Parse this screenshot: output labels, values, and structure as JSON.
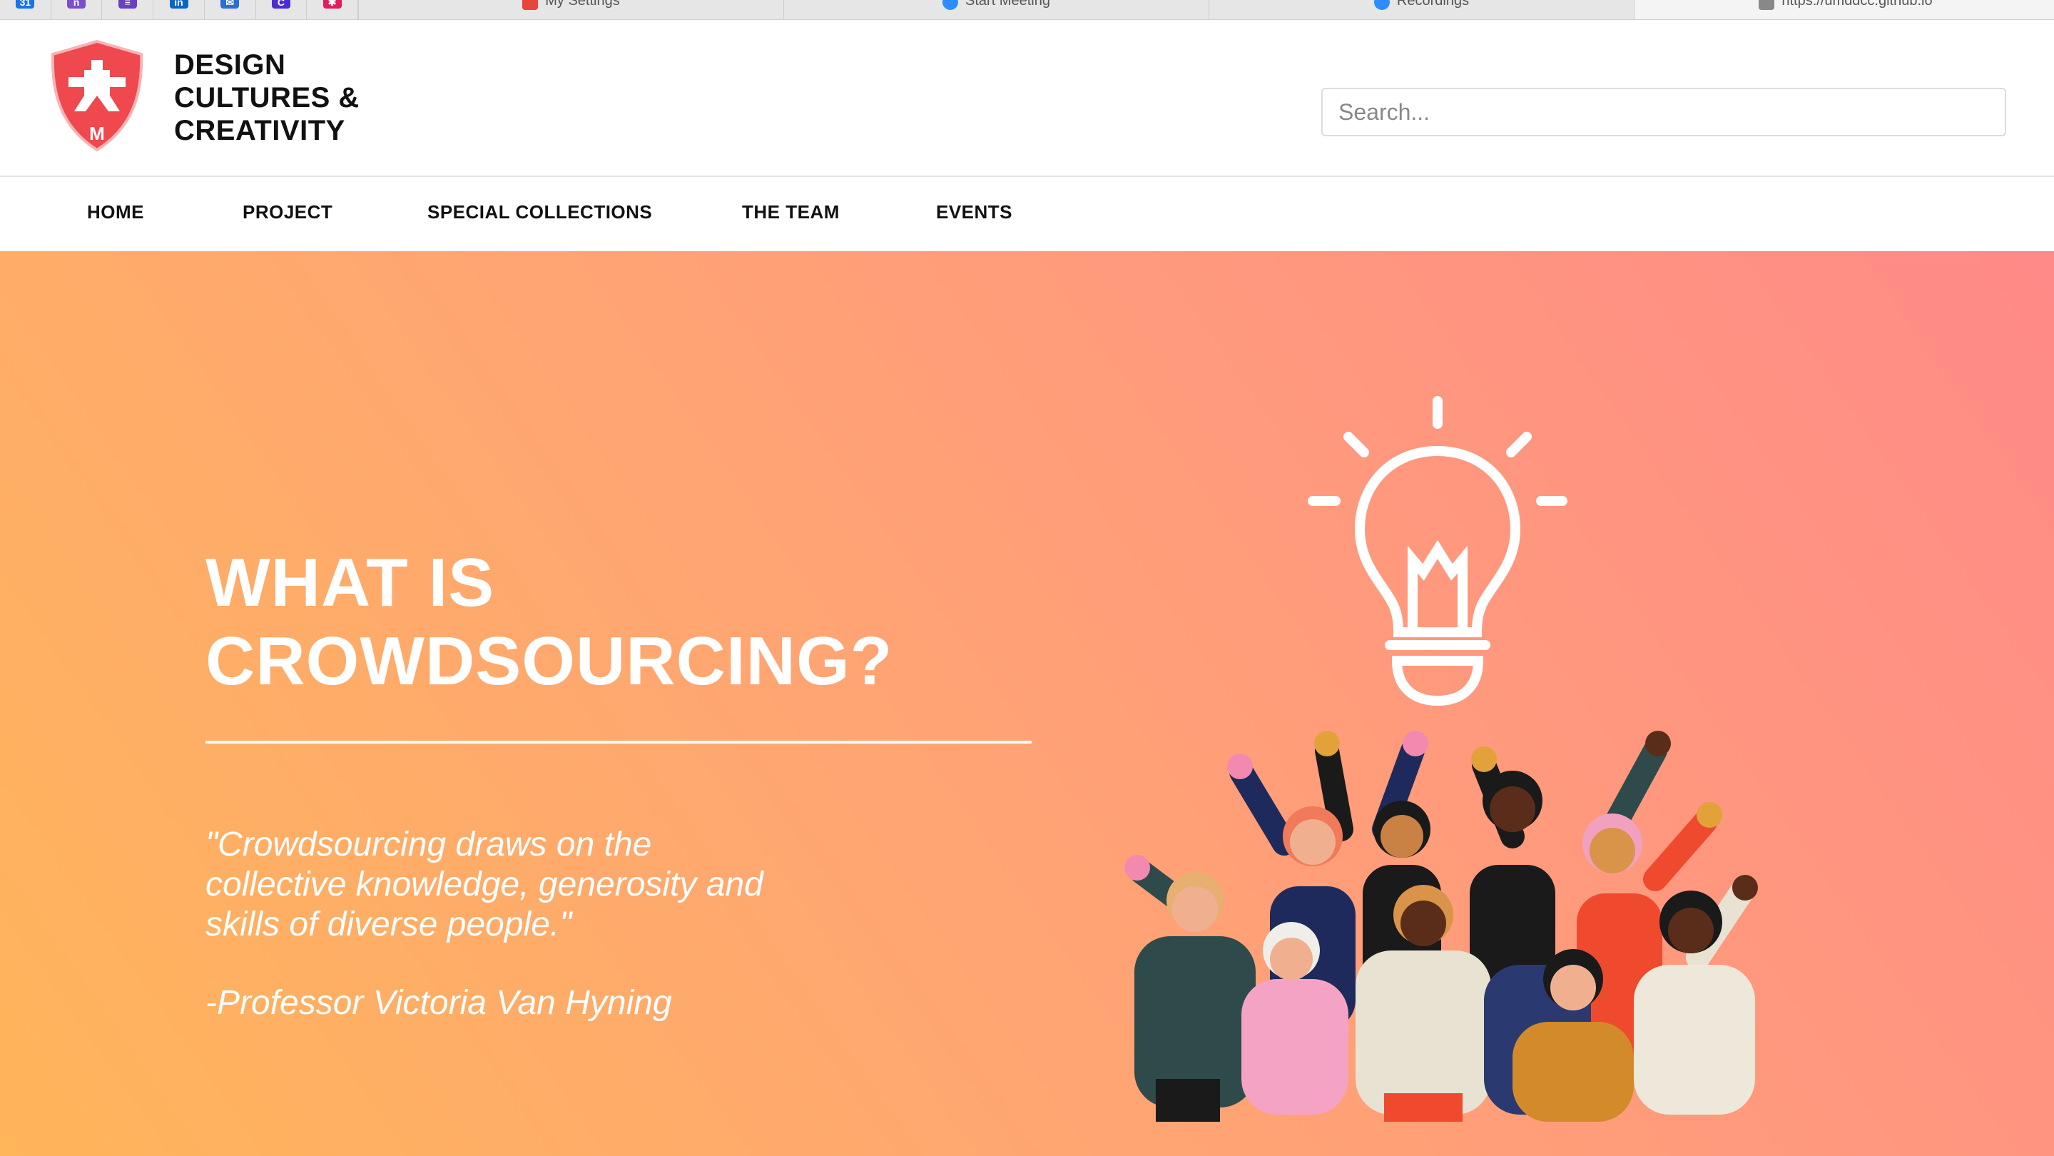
{
  "browser": {
    "favicons": [
      {
        "name": "calendar-favicon",
        "color": "#1a73e8",
        "glyph": "31"
      },
      {
        "name": "notes-favicon",
        "color": "#7b4fc9",
        "glyph": "n"
      },
      {
        "name": "list-favicon",
        "color": "#6a3fc1",
        "glyph": "≡"
      },
      {
        "name": "linkedin-favicon",
        "color": "#0a66c2",
        "glyph": "in"
      },
      {
        "name": "mail-favicon",
        "color": "#2a6fd1",
        "glyph": "✉"
      },
      {
        "name": "canvas-favicon",
        "color": "#4b2bd6",
        "glyph": "C"
      },
      {
        "name": "slack-favicon",
        "color": "#e01e5a",
        "glyph": "✱"
      }
    ],
    "tabs": [
      {
        "label": "My Settings",
        "icon_color": "#e8453c"
      },
      {
        "label": "Start Meeting",
        "icon_color": "#2d8cff"
      },
      {
        "label": "Recordings",
        "icon_color": "#2d8cff"
      },
      {
        "label": "https://umddcc.github.io",
        "icon_color": "#888888"
      }
    ]
  },
  "header": {
    "brand_lines": [
      "DESIGN",
      "CULTURES &",
      "CREATIVITY"
    ],
    "logo_letter": "M",
    "search_placeholder": "Search..."
  },
  "nav": {
    "items": [
      "HOME",
      "PROJECT",
      "SPECIAL COLLECTIONS",
      "THE TEAM",
      "EVENTS"
    ]
  },
  "hero": {
    "title_lines": [
      "WHAT IS",
      "CROWDSOURCING?"
    ],
    "quote_lines": [
      "\"Crowdsourcing draws on the",
      "collective knowledge, generosity and",
      "skills of diverse people.\""
    ],
    "attribution": "-Professor Victoria Van Hyning"
  },
  "colors": {
    "brand_red": "#f0484f",
    "gradient_start": "#ffb55a",
    "gradient_end": "#ff8a87"
  }
}
